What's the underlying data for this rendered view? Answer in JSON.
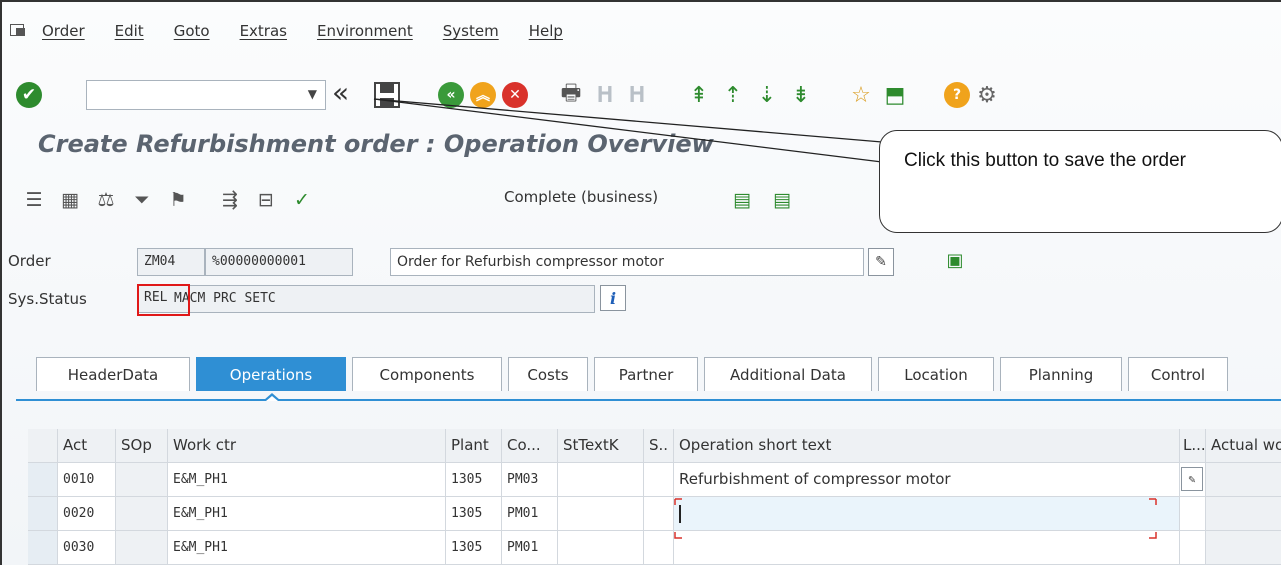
{
  "menu": {
    "items": [
      "Order",
      "Edit",
      "Goto",
      "Extras",
      "Environment",
      "System",
      "Help"
    ]
  },
  "toolbar": {
    "command_value": "",
    "icons": [
      "enter-icon",
      "back-double-icon",
      "save-icon",
      "back-icon",
      "exit-icon",
      "cancel-icon",
      "print-icon",
      "find-icon",
      "find-next-icon",
      "first-page-icon",
      "previous-page-icon",
      "next-page-icon",
      "last-page-icon",
      "create-session-icon",
      "shortcut-icon",
      "help-icon",
      "customize-layout-icon"
    ]
  },
  "title": "Create Refurbishment order : Operation Overview",
  "app_toolbar": {
    "complete_label": "Complete (business)"
  },
  "callout": {
    "text": "Click this button to save the order"
  },
  "order": {
    "label": "Order",
    "type": "ZM04",
    "number": "%00000000001",
    "description": "Order for Refurbish compressor motor"
  },
  "status": {
    "label": "Sys.Status",
    "rel": "REL",
    "rest": "MACM PRC  SETC"
  },
  "tabs": [
    "HeaderData",
    "Operations",
    "Components",
    "Costs",
    "Partner",
    "Additional Data",
    "Location",
    "Planning",
    "Control"
  ],
  "table": {
    "headers": [
      "Act",
      "SOp",
      "Work ctr",
      "Plant",
      "Co...",
      "StTextK",
      "S..",
      "Operation short text",
      "L...",
      "Actual wo"
    ],
    "rows": [
      [
        "0010",
        "",
        "E&M_PH1",
        "1305",
        "PM03",
        "",
        "",
        "Refurbishment of compressor motor",
        "",
        ""
      ],
      [
        "0020",
        "",
        "E&M_PH1",
        "1305",
        "PM01",
        "",
        "",
        "",
        "",
        ""
      ],
      [
        "0030",
        "",
        "E&M_PH1",
        "1305",
        "PM01",
        "",
        "",
        "",
        "",
        ""
      ]
    ]
  },
  "colors": {
    "accent": "#2f8fd4",
    "highlight": "#e01818",
    "ok": "#2e8b2e"
  }
}
